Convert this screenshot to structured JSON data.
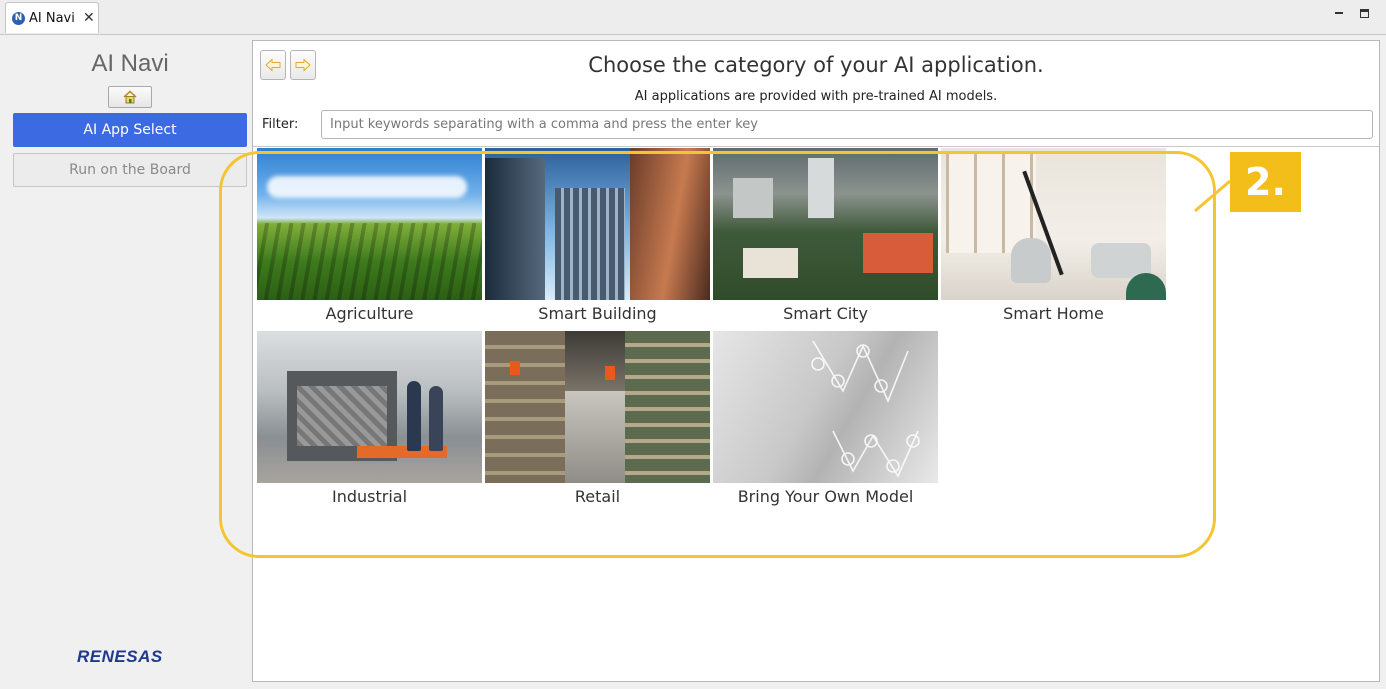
{
  "tab": {
    "icon": "ai-navi-app-icon",
    "label": "AI Navi",
    "close": "✕"
  },
  "window": {
    "minimize_icon": "minimize-icon",
    "maximize_icon": "maximize-icon"
  },
  "sidebar": {
    "title": "AI Navi",
    "home_icon": "home-icon",
    "buttons": [
      {
        "label": "AI App Select",
        "state": "active",
        "color": "#3c6ae2"
      },
      {
        "label": "Run on the Board",
        "state": "inactive"
      }
    ],
    "logo": "RENESAS"
  },
  "header": {
    "back_icon": "arrow-left-icon",
    "forward_icon": "arrow-right-icon",
    "title": "Choose the category of your AI application.",
    "subtitle": "AI applications are provided with pre-trained AI models.",
    "filter_label": "Filter:",
    "filter_value": "",
    "filter_placeholder": "Input keywords separating with a comma and press the enter key"
  },
  "categories": [
    {
      "label": "Agriculture"
    },
    {
      "label": "Smart Building"
    },
    {
      "label": "Smart City"
    },
    {
      "label": "Smart Home"
    },
    {
      "label": "Industrial"
    },
    {
      "label": "Retail"
    },
    {
      "label": "Bring Your Own Model"
    }
  ],
  "annotation": {
    "badge": "2.",
    "color": "#f5c431"
  }
}
